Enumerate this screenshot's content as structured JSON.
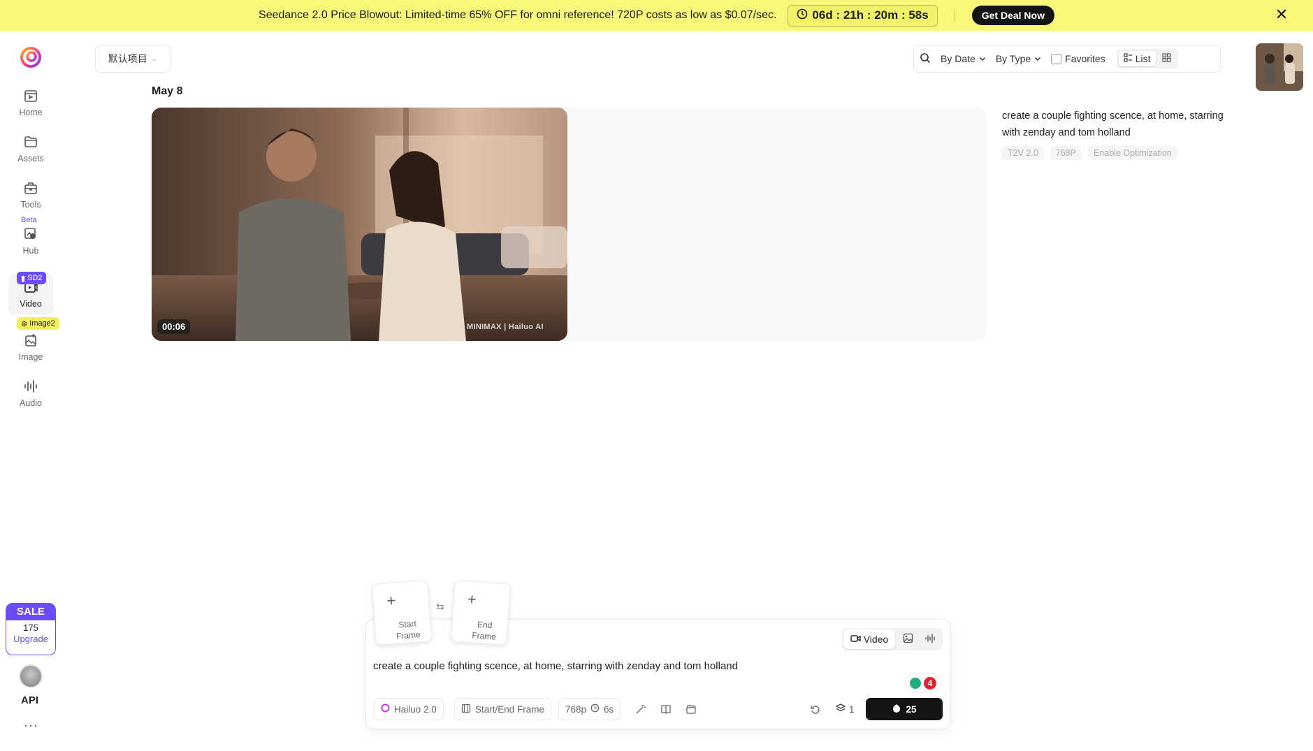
{
  "banner": {
    "text": "Seedance 2.0 Price Blowout: Limited-time 65% OFF for omni reference! 720P costs as low as $0.07/sec.",
    "countdown": "06d : 21h : 20m : 58s",
    "cta": "Get Deal Now"
  },
  "nav": {
    "items": [
      {
        "label": "Home"
      },
      {
        "label": "Assets"
      },
      {
        "label": "Tools"
      },
      {
        "label": "Hub"
      },
      {
        "label": "Video"
      },
      {
        "label": "Image"
      },
      {
        "label": "Audio"
      }
    ],
    "badges": {
      "beta": "Beta",
      "sd2": "SD2",
      "image2": "Image2"
    },
    "sale": {
      "title": "SALE",
      "count": "175",
      "upgrade": "Upgrade"
    },
    "api_label": "API",
    "more": "···"
  },
  "toolbar": {
    "project": "默认项目",
    "by_date": "By Date",
    "by_type": "By Type",
    "favorites": "Favorites",
    "list": "List"
  },
  "content": {
    "date": "May 8",
    "duration": "00:06",
    "watermark": "MINIMAX | Hailuo AI",
    "prompt": "create a couple fighting scence, at home, starring with zenday and tom holland",
    "tags": [
      "T2V 2.0",
      "768P",
      "Enable Optimization"
    ]
  },
  "composer": {
    "start_frame": "Start Frame",
    "end_frame": "End Frame",
    "mode_video": "Video",
    "helper_count": "4",
    "model": "Hailuo 2.0",
    "frame_mode": "Start/End Frame",
    "resolution": "768p",
    "duration": "6s",
    "gen_count": "1",
    "credits": "25",
    "colors": {
      "accent": "#6b4cf6",
      "banner": "#f7f77a",
      "dark": "#141414"
    }
  }
}
